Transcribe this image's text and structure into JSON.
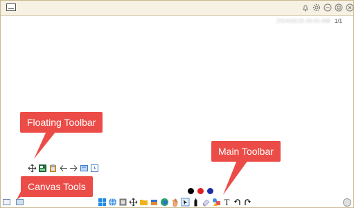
{
  "window": {
    "page_indicator": "1/1",
    "timestamp_blurred": "2024/06/26 09:05:488"
  },
  "callouts": {
    "floating": "Floating Toolbar",
    "main": "Main Toolbar",
    "canvas": "Canvas Tools"
  },
  "floating_toolbar": {
    "icons": [
      "move-icon",
      "template-icon",
      "clipboard-icon",
      "undo-arrow-icon",
      "redo-arrow-icon",
      "blackboard-icon",
      "timer-icon"
    ]
  },
  "canvas_tools": {
    "icons": [
      "board-icon",
      "image-icon"
    ]
  },
  "color_picker": {
    "colors": [
      "#000000",
      "#e02020",
      "#1c2fa8"
    ]
  },
  "main_toolbar": {
    "icons": [
      "windows-start-icon",
      "browser-icon",
      "screenshot-icon",
      "move-icon",
      "folder-icon",
      "box-icon",
      "edge-icon",
      "hand-icon",
      "select-icon",
      "pen-icon",
      "eraser-icon",
      "shape-icon",
      "text-tool-icon",
      "undo-icon",
      "redo-icon"
    ],
    "text_tool_glyph": "T"
  }
}
